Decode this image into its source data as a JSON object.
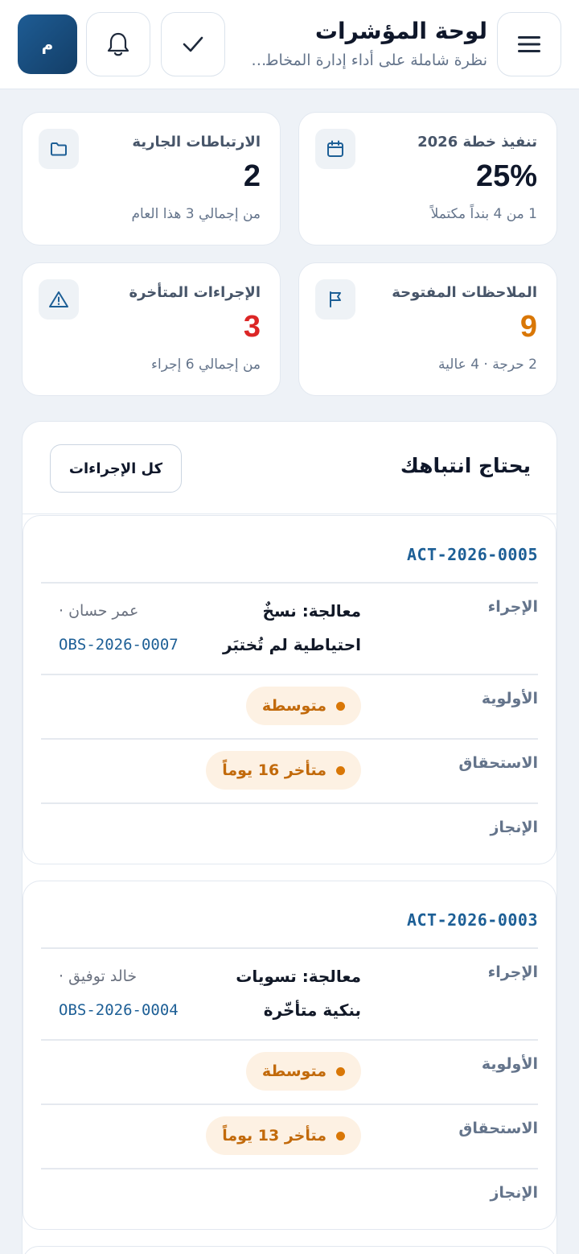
{
  "header": {
    "title": "لوحة المؤشرات",
    "subtitle": "نظرة شاملة على أداء إدارة المخاطر والامتثال",
    "avatar_initial": "م",
    "icons": {
      "menu": "menu-icon",
      "check": "check-icon",
      "bell": "bell-icon"
    }
  },
  "stats": [
    {
      "label": "تنفيذ خطة 2026",
      "value": "25%",
      "sub": "1 من 4 بنداً مكتملاً",
      "icon": "calendar-icon",
      "value_color": "#0f172a"
    },
    {
      "label": "الارتباطات الجارية",
      "value": "2",
      "sub": "من إجمالي 3 هذا العام",
      "icon": "folder-icon",
      "value_color": "#0f172a"
    },
    {
      "label": "الملاحظات المفتوحة",
      "value": "9",
      "sub": "2 حرجة · 4 عالية",
      "icon": "flag-icon",
      "value_color": "#d97706"
    },
    {
      "label": "الإجراءات المتأخرة",
      "value": "3",
      "sub": "من إجمالي 6 إجراء",
      "icon": "warning-icon",
      "value_color": "#dc2626"
    }
  ],
  "attention": {
    "title": "يحتاج انتباهك",
    "all_actions_label": "كل الإجراءات",
    "row_labels": {
      "action": "الإجراء",
      "priority": "الأولوية",
      "due": "الاستحقاق",
      "completion": "الإنجاز"
    },
    "items": [
      {
        "id": "ACT-2026-0005",
        "action_line1": "معالجة: نسخٌ",
        "action_line2": "احتياطية لم تُختبَر",
        "owner": "عمر حسان ·",
        "ref": "OBS-2026-0007",
        "priority": "متوسطة",
        "due": "متأخر 16 يوماً"
      },
      {
        "id": "ACT-2026-0003",
        "action_line1": "معالجة: تسويات",
        "action_line2": "بنكية متأخّرة",
        "owner": "خالد توفيق ·",
        "ref": "OBS-2026-0004",
        "priority": "متوسطة",
        "due": "متأخر 13 يوماً"
      }
    ]
  },
  "colors": {
    "accent": "#1d5f96",
    "warning": "#d97706",
    "danger": "#dc2626",
    "pill_bg": "#fdf1e3"
  }
}
